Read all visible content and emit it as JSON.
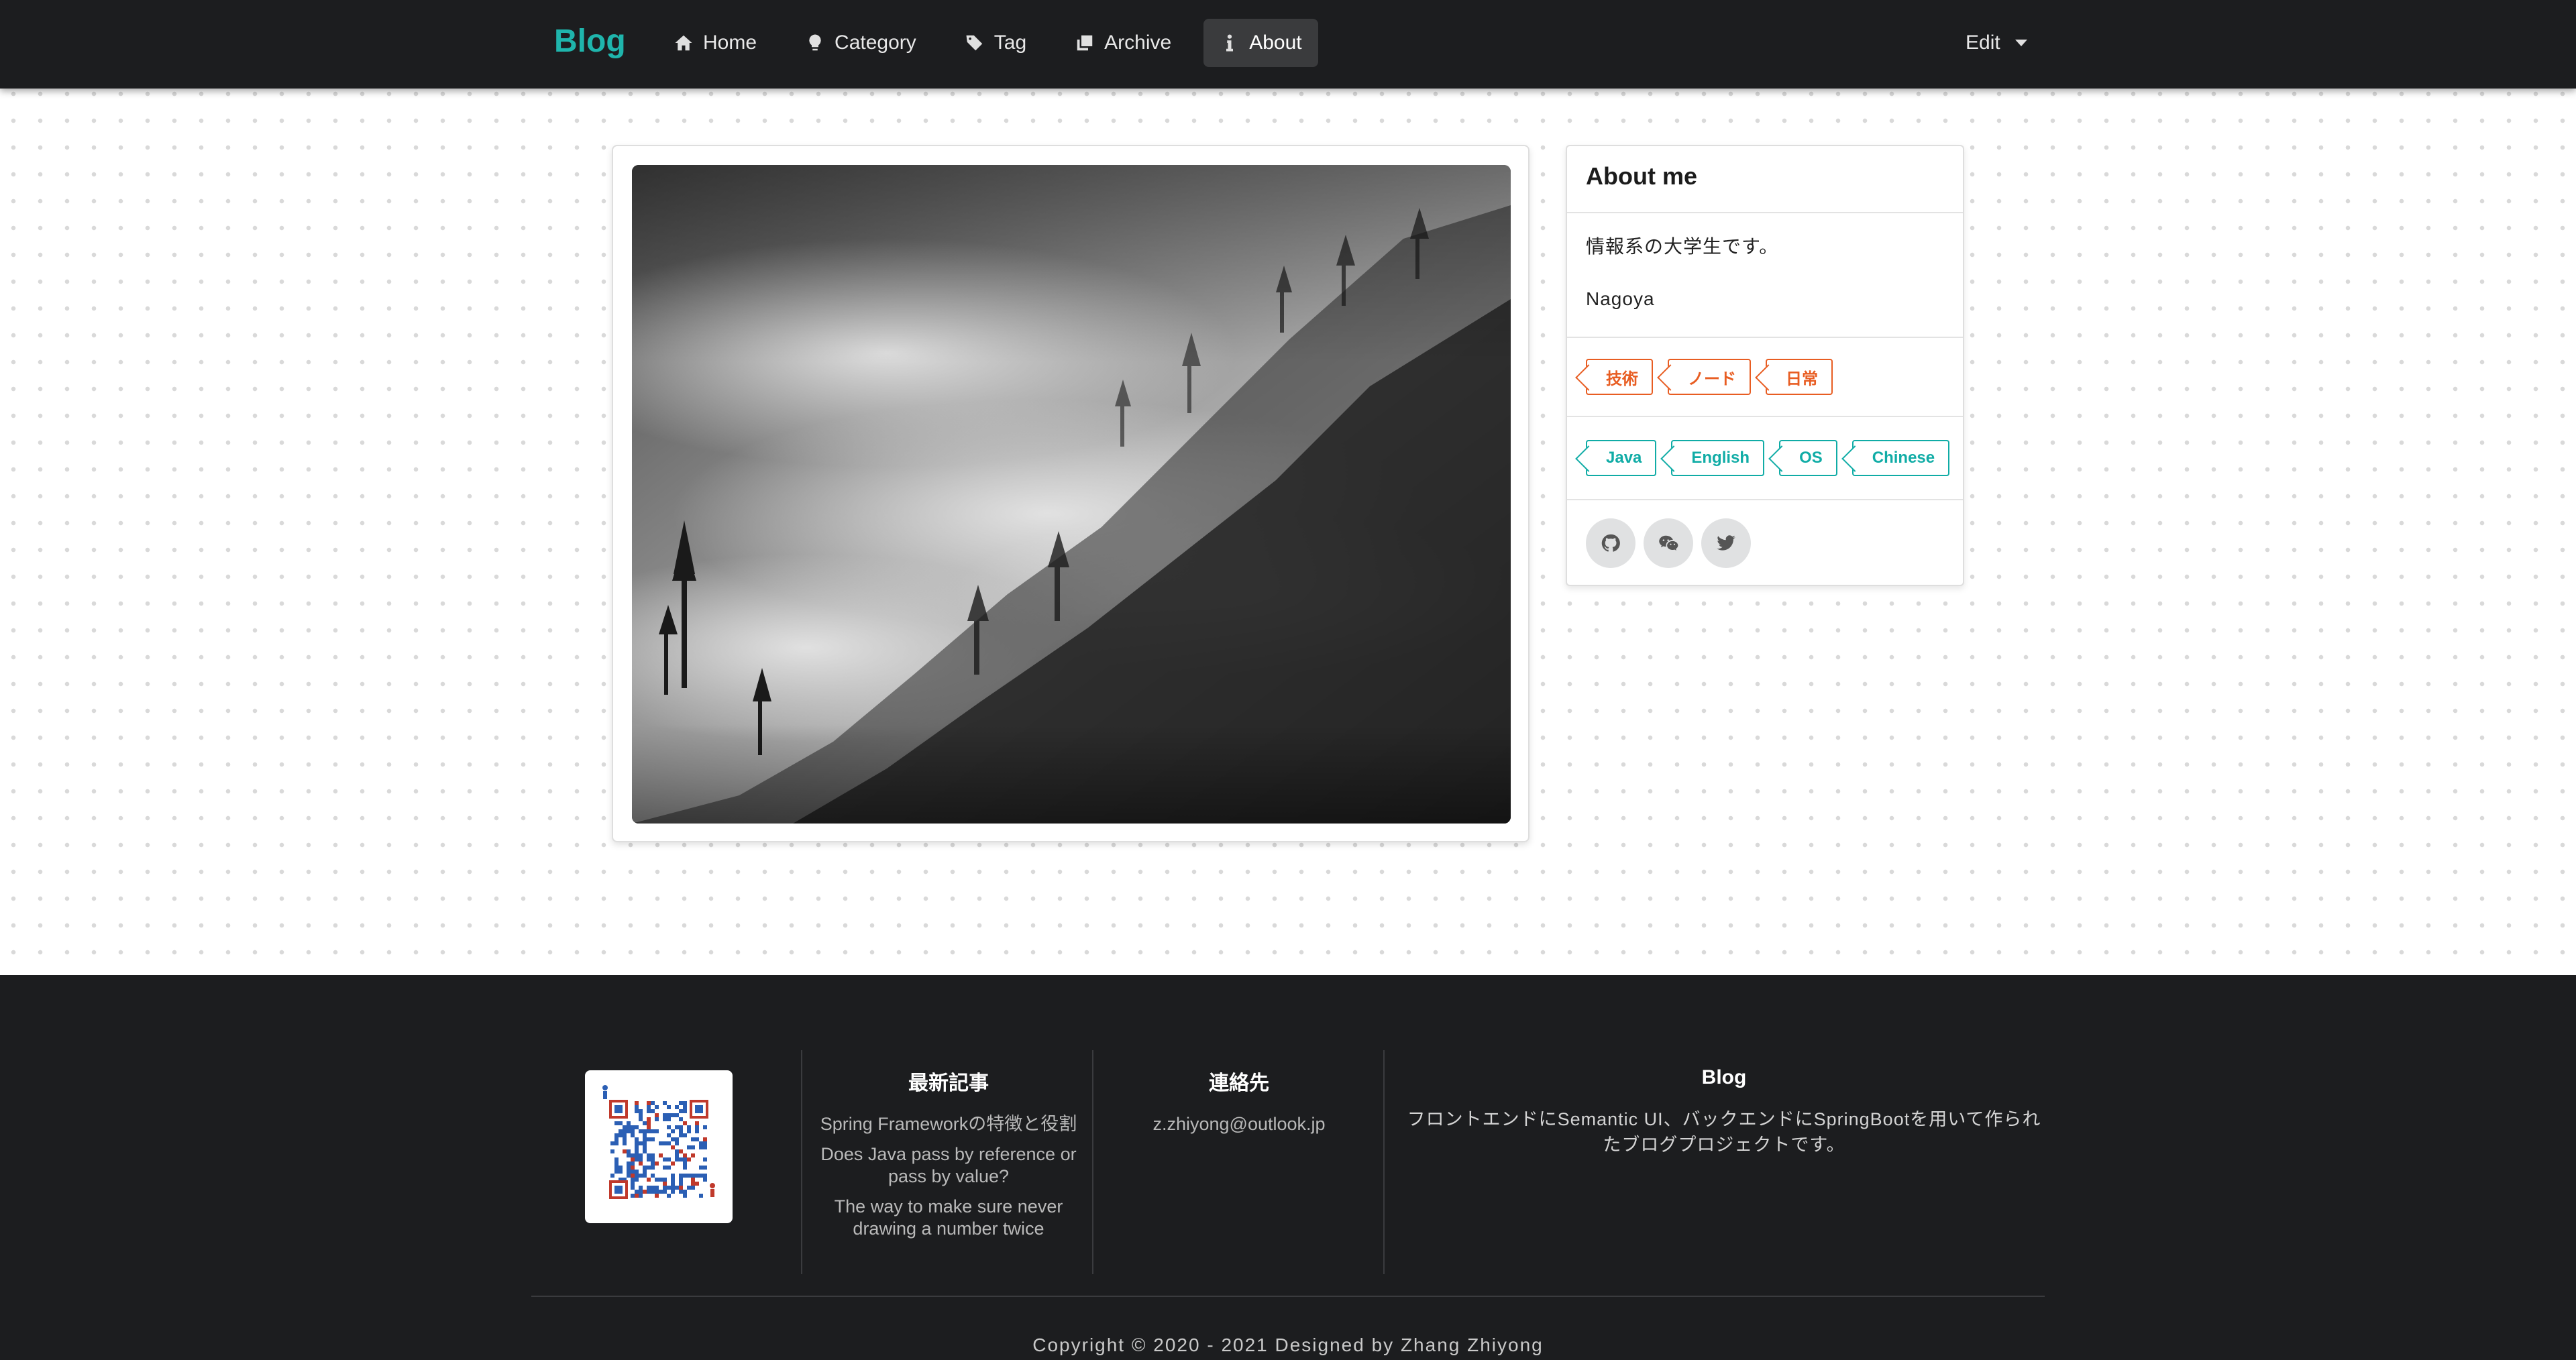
{
  "nav": {
    "brand": "Blog",
    "items": [
      {
        "label": "Home",
        "icon": "home-icon"
      },
      {
        "label": "Category",
        "icon": "lightbulb-icon"
      },
      {
        "label": "Tag",
        "icon": "tags-icon"
      },
      {
        "label": "Archive",
        "icon": "clone-icon"
      },
      {
        "label": "About",
        "icon": "info-icon",
        "active": true
      }
    ],
    "edit_label": "Edit"
  },
  "about": {
    "title": "About me",
    "description": "情報系の大学生です。",
    "location": "Nagoya",
    "category_tags": [
      "技術",
      "ノード",
      "日常"
    ],
    "skill_tags": [
      "Java",
      "English",
      "OS",
      "Chinese"
    ],
    "social_icons": [
      "github-icon",
      "wechat-icon",
      "twitter-icon"
    ]
  },
  "footer": {
    "recent_title": "最新記事",
    "recent_posts": [
      "Spring Frameworkの特徴と役割",
      "Does Java pass by reference or pass by value?",
      "The way to make sure never drawing a number twice"
    ],
    "contact_title": "連絡先",
    "email": "z.zhiyong@outlook.jp",
    "blog_title": "Blog",
    "blog_desc": "フロントエンドにSemantic UI、バックエンドにSpringBootを用いて作られたブログプロジェクトです。",
    "copyright": "Copyright © 2020 - 2021 Designed by Zhang Zhiyong"
  },
  "colors": {
    "navbar": "#1c1d1f",
    "brand": "#1fb5ac",
    "tag_orange": "#e85d22",
    "tag_teal": "#10aca6"
  }
}
